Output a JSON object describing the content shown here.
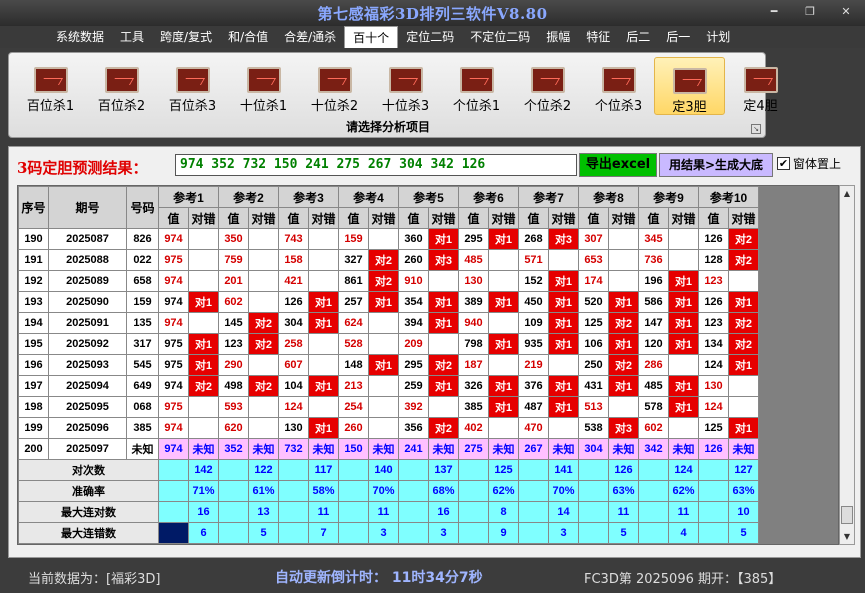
{
  "app": {
    "title": "第七感福彩3D排列三软件V8.80"
  },
  "menu": [
    "系统数据",
    "工具",
    "跨度/复式",
    "和/合值",
    "合差/通杀",
    "百十个",
    "定位二码",
    "不定位二码",
    "振幅",
    "特征",
    "后二",
    "后一",
    "计划"
  ],
  "menu_active": 5,
  "ribbon": {
    "items": [
      "百位杀1",
      "百位杀2",
      "百位杀3",
      "十位杀1",
      "十位杀2",
      "十位杀3",
      "个位杀1",
      "个位杀2",
      "个位杀3",
      "定3胆",
      "定4胆"
    ],
    "selected": 9,
    "group_label": "请选择分析项目"
  },
  "result": {
    "label": "3码定胆预测结果：",
    "value": "974 352 732 150 241 275 267 304 342 126",
    "excel_button": "导出excel",
    "generate_button": "用结果>生成大底",
    "topmost_label": "窗体置上",
    "topmost_checked": true
  },
  "table": {
    "h_seq": "序号",
    "h_period": "期号",
    "h_num": "号码",
    "refs": [
      "参考1",
      "参考2",
      "参考3",
      "参考4",
      "参考5",
      "参考6",
      "参考7",
      "参考8",
      "参考9",
      "参考10"
    ],
    "sub_val": "值",
    "sub_mark": "对错",
    "rows": [
      {
        "seq": "190",
        "period": "2025087",
        "num": "826",
        "vals": [
          "974",
          "350",
          "743",
          "159",
          "360",
          "295",
          "268",
          "307",
          "345",
          "126"
        ],
        "marks": [
          "",
          "",
          "",
          "",
          "对1",
          "对1",
          "对3",
          "",
          "",
          "对2"
        ]
      },
      {
        "seq": "191",
        "period": "2025088",
        "num": "022",
        "vals": [
          "975",
          "759",
          "158",
          "327",
          "260",
          "485",
          "571",
          "653",
          "736",
          "128"
        ],
        "marks": [
          "",
          "",
          "",
          "对2",
          "对3",
          "",
          "",
          "",
          "",
          "对2"
        ]
      },
      {
        "seq": "192",
        "period": "2025089",
        "num": "658",
        "vals": [
          "974",
          "201",
          "421",
          "861",
          "910",
          "130",
          "152",
          "174",
          "196",
          "123"
        ],
        "marks": [
          "",
          "",
          "",
          "对2",
          "",
          "",
          "对1",
          "",
          "对1",
          ""
        ]
      },
      {
        "seq": "193",
        "period": "2025090",
        "num": "159",
        "vals": [
          "974",
          "602",
          "126",
          "257",
          "354",
          "389",
          "450",
          "520",
          "586",
          "126"
        ],
        "marks": [
          "对1",
          "",
          "对1",
          "对1",
          "对1",
          "对1",
          "对1",
          "对1",
          "对1",
          "对1"
        ]
      },
      {
        "seq": "194",
        "period": "2025091",
        "num": "135",
        "vals": [
          "974",
          "145",
          "304",
          "624",
          "394",
          "940",
          "109",
          "125",
          "147",
          "123"
        ],
        "marks": [
          "",
          "对2",
          "对1",
          "",
          "对1",
          "",
          "对1",
          "对2",
          "对1",
          "对2"
        ]
      },
      {
        "seq": "195",
        "period": "2025092",
        "num": "317",
        "vals": [
          "975",
          "123",
          "258",
          "528",
          "209",
          "798",
          "935",
          "106",
          "120",
          "134"
        ],
        "marks": [
          "对1",
          "对2",
          "",
          "",
          "",
          "对1",
          "对1",
          "对1",
          "对1",
          "对2"
        ]
      },
      {
        "seq": "196",
        "period": "2025093",
        "num": "545",
        "vals": [
          "975",
          "290",
          "607",
          "148",
          "295",
          "187",
          "219",
          "250",
          "286",
          "124"
        ],
        "marks": [
          "对1",
          "",
          "",
          "对1",
          "对2",
          "",
          "",
          "对2",
          "",
          "对1"
        ]
      },
      {
        "seq": "197",
        "period": "2025094",
        "num": "649",
        "vals": [
          "974",
          "498",
          "104",
          "213",
          "259",
          "326",
          "376",
          "431",
          "485",
          "130"
        ],
        "marks": [
          "对2",
          "对2",
          "对1",
          "",
          "对1",
          "对1",
          "对1",
          "对1",
          "对1",
          ""
        ]
      },
      {
        "seq": "198",
        "period": "2025095",
        "num": "068",
        "vals": [
          "975",
          "593",
          "124",
          "254",
          "392",
          "385",
          "487",
          "513",
          "578",
          "124"
        ],
        "marks": [
          "",
          "",
          "",
          "",
          "",
          "对1",
          "对1",
          "",
          "对1",
          ""
        ]
      },
      {
        "seq": "199",
        "period": "2025096",
        "num": "385",
        "vals": [
          "974",
          "620",
          "130",
          "260",
          "356",
          "402",
          "470",
          "538",
          "602",
          "125"
        ],
        "marks": [
          "",
          "",
          "对1",
          "",
          "对2",
          "",
          "",
          "对3",
          "",
          "对1"
        ]
      }
    ],
    "pred": {
      "seq": "200",
      "period": "2025097",
      "num": "未知",
      "vals": [
        "974",
        "352",
        "732",
        "150",
        "241",
        "275",
        "267",
        "304",
        "342",
        "126"
      ],
      "mark": "未知"
    },
    "stats": [
      {
        "label": "对次数",
        "values": [
          "142",
          "122",
          "117",
          "140",
          "137",
          "125",
          "141",
          "126",
          "124",
          "127"
        ]
      },
      {
        "label": "准确率",
        "values": [
          "71%",
          "61%",
          "58%",
          "70%",
          "68%",
          "62%",
          "70%",
          "63%",
          "62%",
          "63%"
        ]
      },
      {
        "label": "最大连对数",
        "values": [
          "16",
          "13",
          "11",
          "11",
          "16",
          "8",
          "14",
          "11",
          "11",
          "10"
        ]
      },
      {
        "label": "最大连错数",
        "values": [
          "6",
          "5",
          "7",
          "3",
          "3",
          "9",
          "3",
          "5",
          "4",
          "5"
        ]
      }
    ]
  },
  "status": {
    "current": "当前数据为：[福彩3D]",
    "countdown": "自动更新倒计时： 11时34分7秒",
    "issue": "FC3D第 2025096 期开：【385】"
  },
  "colors": {
    "hit": "#e60000",
    "value_red": "#d40000",
    "pred_row": "#ffc0ff",
    "stat_row": "#7fffff",
    "stat_text": "#0000ff",
    "excel": "#00c000",
    "gen": "#c9b9ff"
  }
}
